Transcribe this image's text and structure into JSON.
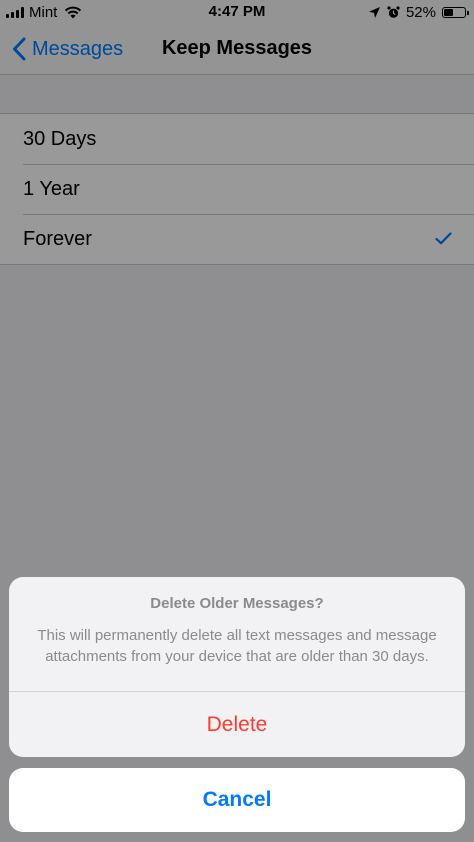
{
  "status_bar": {
    "carrier": "Mint",
    "time": "4:47 PM",
    "battery_percent_label": "52%",
    "battery_level": 0.52,
    "icons": [
      "signal-icon",
      "wifi-icon",
      "location-arrow-icon",
      "alarm-clock-icon",
      "battery-icon"
    ]
  },
  "nav": {
    "back_label": "Messages",
    "title": "Keep Messages"
  },
  "options": [
    {
      "label": "30 Days",
      "selected": false
    },
    {
      "label": "1 Year",
      "selected": false
    },
    {
      "label": "Forever",
      "selected": true
    }
  ],
  "action_sheet": {
    "title": "Delete Older Messages?",
    "message": "This will permanently delete all text messages and message attachments from your device that are older than 30 days.",
    "destructive_label": "Delete",
    "cancel_label": "Cancel"
  },
  "colors": {
    "accent": "#007aff",
    "destructive": "#ff3b30",
    "checkmark": "#007aff"
  }
}
